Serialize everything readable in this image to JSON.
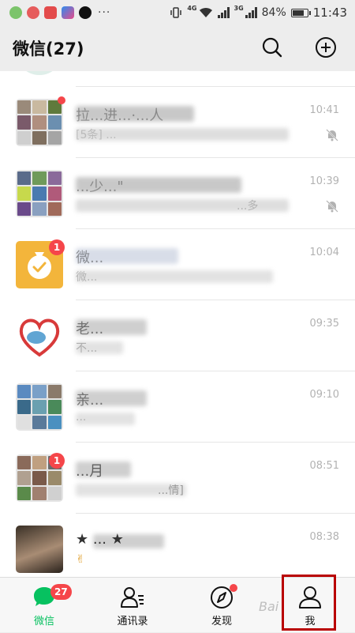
{
  "status_bar": {
    "network_1": "4G",
    "network_2": "3G",
    "battery": "84%",
    "battery_level": 0.84,
    "time": "11:43"
  },
  "header": {
    "title": "微信(27)",
    "search_icon": "search-icon",
    "add_icon": "plus-circle-icon"
  },
  "chats": [
    {
      "name": "拉...进...·...人",
      "preview": "[5条] ...",
      "time": "10:41",
      "badge_type": "dot",
      "muted": true
    },
    {
      "name": "...少...\"",
      "preview": "...多",
      "time": "10:39",
      "badge_type": "none",
      "muted": true
    },
    {
      "name": "微...",
      "preview": "微...",
      "time": "10:04",
      "badge_type": "count",
      "badge": "1",
      "muted": false
    },
    {
      "name": "老...",
      "preview": "不...",
      "time": "09:35",
      "badge_type": "none",
      "muted": false
    },
    {
      "name": "亲...",
      "preview": "...",
      "time": "09:10",
      "badge_type": "none",
      "muted": false
    },
    {
      "name": "...月",
      "preview": "...情]",
      "time": "08:51",
      "badge_type": "count",
      "badge": "1",
      "muted": false
    },
    {
      "name": "★ ... ★",
      "preview": "✌",
      "time": "08:38",
      "badge_type": "none",
      "muted": false
    }
  ],
  "tabbar": {
    "tabs": [
      {
        "label": "微信",
        "icon": "chat-bubble-icon",
        "badge": "27",
        "active": true
      },
      {
        "label": "通讯录",
        "icon": "contacts-icon",
        "active": false
      },
      {
        "label": "发现",
        "icon": "compass-icon",
        "dot": true,
        "active": false
      },
      {
        "label": "我",
        "icon": "person-icon",
        "active": false
      }
    ]
  },
  "watermark": "Bai",
  "colors": {
    "accent": "#07c160",
    "badge": "#f5464a",
    "highlight": "#b90000"
  }
}
